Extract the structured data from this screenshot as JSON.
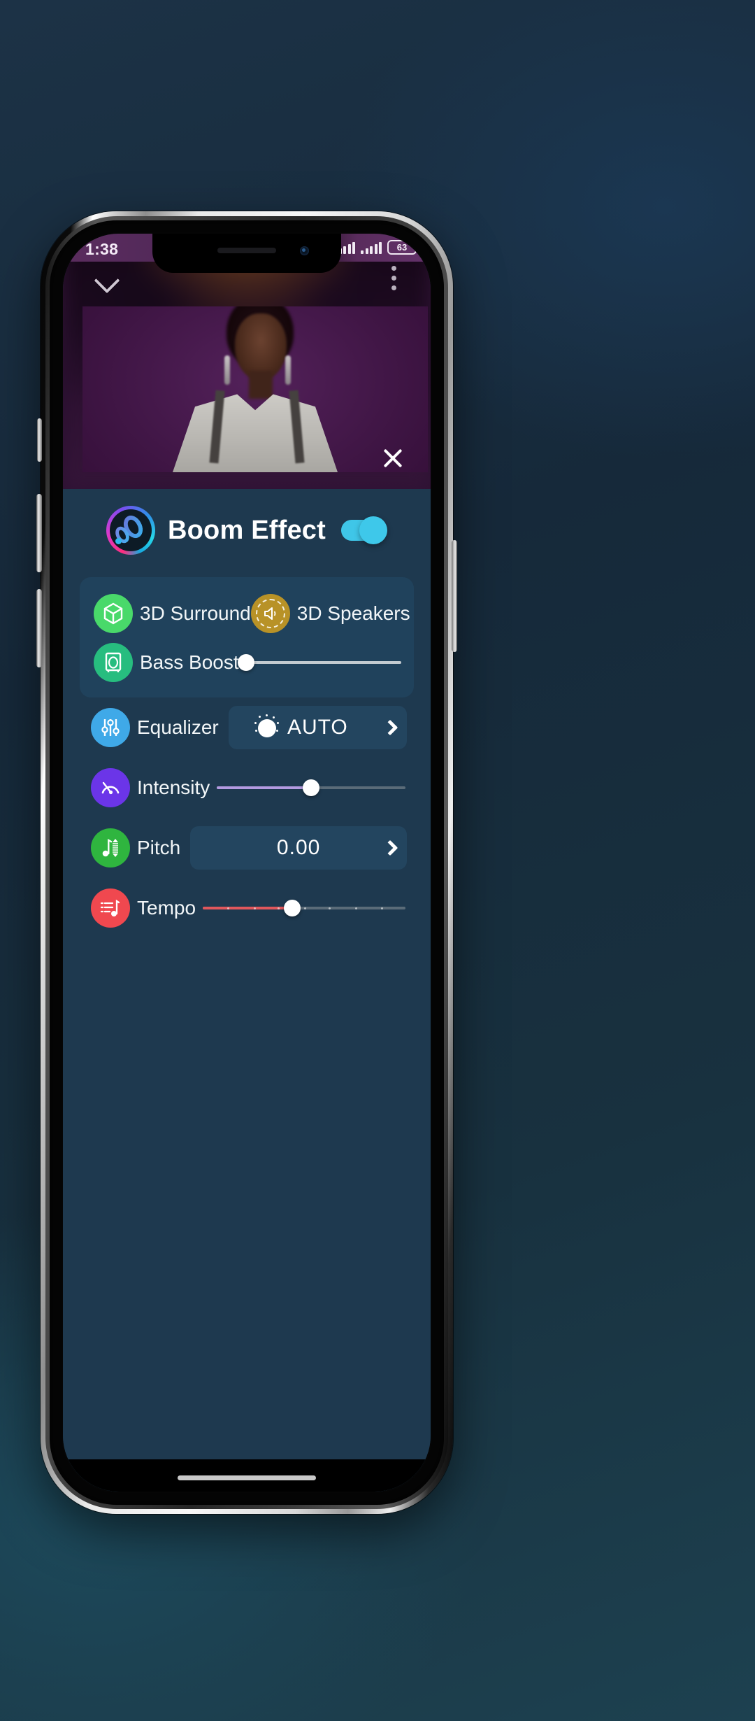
{
  "status_bar": {
    "time": "1:38",
    "battery_percent": "63",
    "signal_icon": "signal-bars-icon",
    "signal_icon_2": "signal-bars-icon",
    "battery_icon": "battery-icon"
  },
  "video_header": {
    "collapse_icon": "chevron-down-icon",
    "overflow_icon": "kebab-menu-icon",
    "close_icon": "close-icon",
    "thumbnail_name": "video-thumbnail"
  },
  "brand": {
    "title": "Boom Effect",
    "logo_icon": "boom-logo-icon",
    "toggle_on": true,
    "toggle_color": "#3ec8ea"
  },
  "effects_card": {
    "surround": {
      "label": "3D Surround",
      "icon": "cube-3d-icon",
      "color": "#49d96a"
    },
    "speakers": {
      "label": "3D Speakers",
      "icon": "speaker-surround-icon",
      "color": "#b89227"
    },
    "bass": {
      "label": "Bass Boost",
      "icon": "bass-speaker-icon",
      "color": "#27bd7f",
      "value_percent": 0,
      "track_color": "#c3cbd1",
      "fill_color": "#c3cbd1"
    }
  },
  "settings": [
    {
      "name": "equalizer",
      "label": "Equalizer",
      "icon": "equalizer-sliders-icon",
      "icon_color": "#3fa9e8",
      "control": "value-box",
      "value": "AUTO",
      "value_icon": "dial-knob-icon",
      "chevron": "chevron-right-icon"
    },
    {
      "name": "intensity",
      "label": "Intensity",
      "icon": "gauge-icon",
      "icon_color": "#6b35e8",
      "control": "slider",
      "value_percent": 50,
      "fill_color": "#b39ae0",
      "track_color": "#5a6b78"
    },
    {
      "name": "pitch",
      "label": "Pitch",
      "icon": "pitch-note-icon",
      "icon_color": "#2fb53f",
      "control": "value-box",
      "value": "0.00",
      "chevron": "chevron-right-icon"
    },
    {
      "name": "tempo",
      "label": "Tempo",
      "icon": "tempo-note-icon",
      "icon_color": "#f0484f",
      "control": "slider",
      "value_percent": 44,
      "fill_color": "#e0575c",
      "track_color": "#5a6b78"
    }
  ],
  "theme": {
    "panel_bg": "#1e394f",
    "card_bg": "#20425c",
    "value_box_bg": "#23455f",
    "text_primary": "#ffffff"
  }
}
